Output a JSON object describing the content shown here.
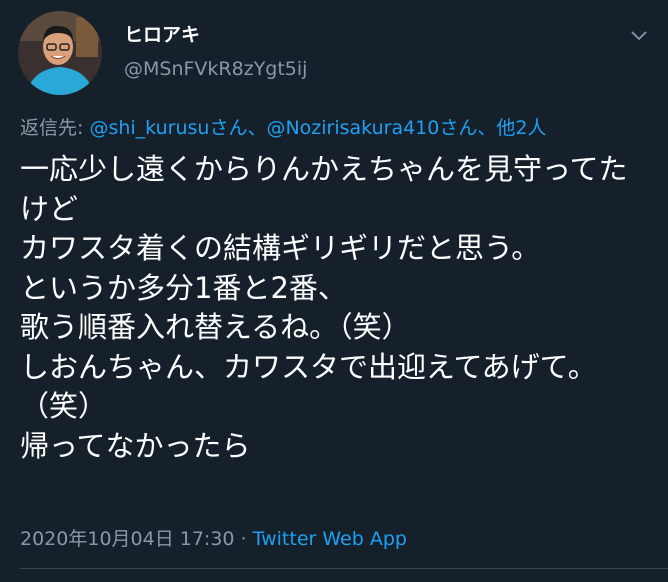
{
  "author": {
    "display_name": "ヒロアキ",
    "handle": "@MSnFVkR8zYgt5ij"
  },
  "reply": {
    "prefix": "返信先: ",
    "user1": "@shi_kurusu",
    "suffix1": "さん、",
    "user2": "@Nozirisakura410",
    "suffix2": "さん、",
    "others": "他2人"
  },
  "tweet": {
    "text": "一応少し遠くからりんかえちゃんを見守ってたけど\nカワスタ着くの結構ギリギリだと思う。\nというか多分1番と2番、\n歌う順番入れ替えるね。（笑）\nしおんちゃん、カワスタで出迎えてあげて。（笑）\n帰ってなかったら"
  },
  "meta": {
    "timestamp": "2020年10月04日 17:30",
    "separator": " · ",
    "source": "Twitter Web App"
  },
  "colors": {
    "background": "#15202b",
    "text": "#ffffff",
    "secondary": "#8899a6",
    "link": "#1da1f2",
    "avatar_shirt": "#2aa8d8"
  },
  "icons": {
    "caret": "chevron-down-icon",
    "avatar": "avatar"
  }
}
